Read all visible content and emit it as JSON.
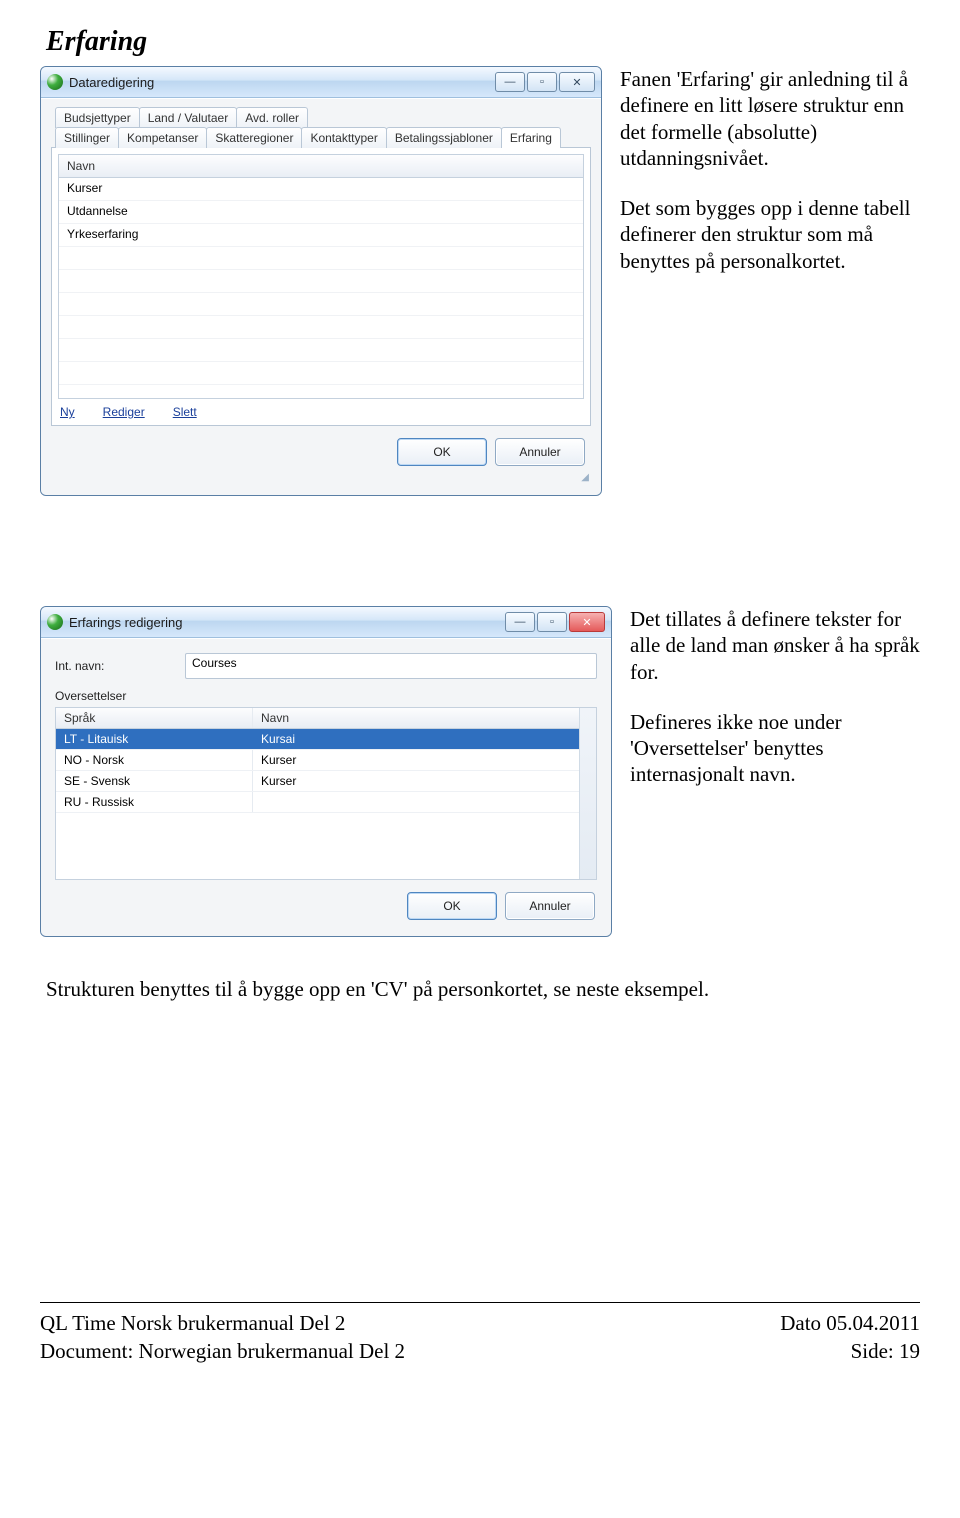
{
  "heading": "Erfaring",
  "win1": {
    "title": "Dataredigering",
    "win_min": "—",
    "win_max": "▫",
    "win_close": "✕",
    "tabs_row1": [
      "Budsjettyper",
      "Land / Valutaer",
      "Avd. roller"
    ],
    "tabs_row2": [
      "Stillinger",
      "Kompetanser",
      "Skatteregioner",
      "Kontakttyper",
      "Betalingssjabloner",
      "Erfaring"
    ],
    "grid_header": "Navn",
    "rows": [
      "Kurser",
      "Utdannelse",
      "Yrkeserfaring"
    ],
    "links": {
      "ny": "Ny",
      "rediger": "Rediger",
      "slett": "Slett"
    },
    "ok": "OK",
    "cancel": "Annuler"
  },
  "side1": {
    "p1": "Fanen 'Erfaring' gir anledning til å definere en litt løsere struktur enn det formelle (absolutte) utdanningsnivået.",
    "p2": "Det som bygges opp i denne tabell definerer den struktur som må benyttes på personalkortet."
  },
  "win2": {
    "title": "Erfarings redigering",
    "win_min": "—",
    "win_max": "▫",
    "win_close": "✕",
    "intnavn_label": "Int. navn:",
    "intnavn_value": "Courses",
    "oversettelser_label": "Oversettelser",
    "col_sprak": "Språk",
    "col_navn": "Navn",
    "rows": [
      {
        "lang": "LT - Litauisk",
        "name": "Kursai",
        "selected": true
      },
      {
        "lang": "NO - Norsk",
        "name": "Kurser",
        "selected": false
      },
      {
        "lang": "SE - Svensk",
        "name": "Kurser",
        "selected": false
      },
      {
        "lang": "RU - Russisk",
        "name": "",
        "selected": false
      }
    ],
    "ok": "OK",
    "cancel": "Annuler"
  },
  "side2": {
    "p1": "Det tillates å definere tekster for alle de land man ønsker å ha språk for.",
    "p2": "Defineres ikke noe under 'Oversettelser' benyttes internasjonalt navn."
  },
  "bottom_para": "Strukturen benyttes til å bygge opp en 'CV' på personkortet, se neste eksempel.",
  "footer": {
    "l1": "QL Time Norsk brukermanual Del 2",
    "l2": "Document: Norwegian brukermanual Del 2",
    "r1": "Dato 05.04.2011",
    "r2": "Side: 19"
  }
}
